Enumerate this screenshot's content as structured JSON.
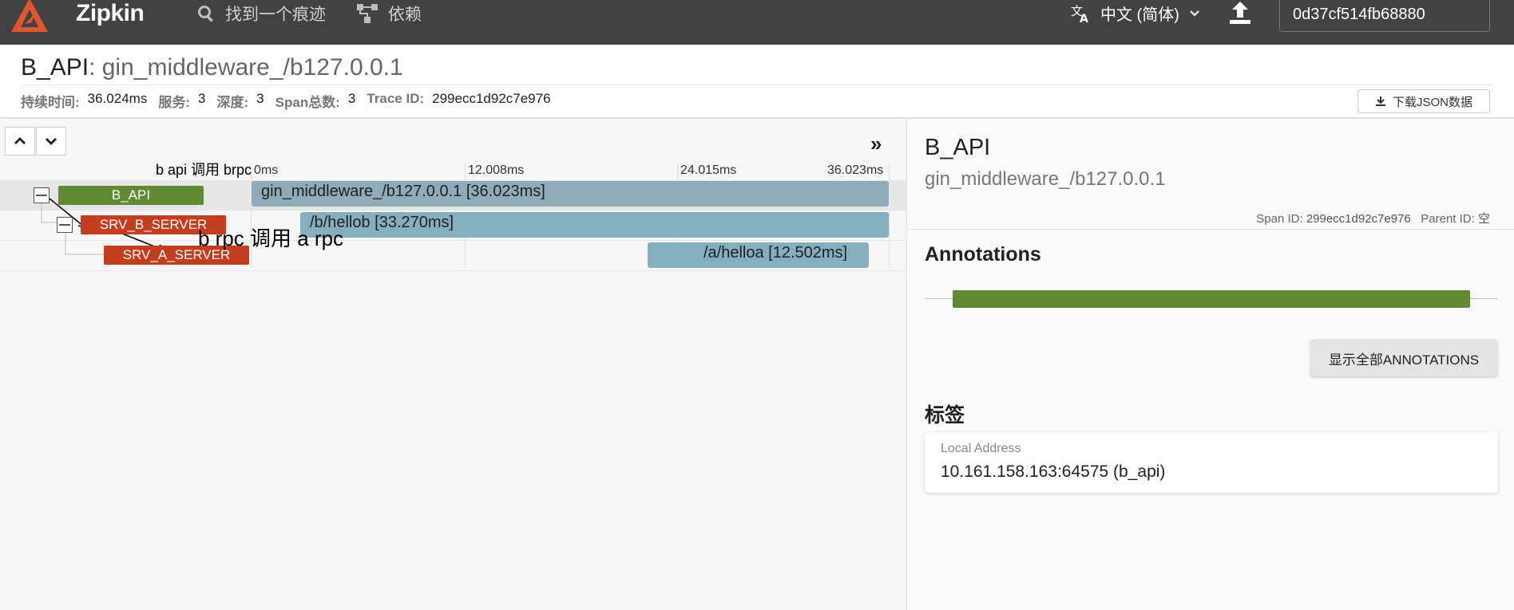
{
  "appbar": {
    "brand": "Zipkin",
    "nav": [
      {
        "label": "找到一个痕迹",
        "icon": "search-icon"
      },
      {
        "label": "依赖",
        "icon": "dependency-icon"
      }
    ],
    "language": "中文 (简体)",
    "trace_id_value": "0d37cf514fb68880",
    "colors": {
      "bar": "#424242",
      "logo": "#e1562a"
    }
  },
  "header": {
    "service": "B_API",
    "sep": ": ",
    "span_name": "gin_middleware_/b127.0.0.1",
    "meta": [
      {
        "key": "持续时间:",
        "value": "36.024ms"
      },
      {
        "key": "服务:",
        "value": "3"
      },
      {
        "key": "深度:",
        "value": "3"
      },
      {
        "key": "Span总数:",
        "value": "3"
      },
      {
        "key": "Trace ID:",
        "value": "299ecc1d92c7e976"
      }
    ],
    "download_label": "下载JSON数据"
  },
  "timeline": {
    "ticks": [
      "0ms",
      "12.008ms",
      "24.015ms",
      "36.023ms"
    ],
    "annotations": [
      "b api 调用 brpc",
      "b rpc 调用 a rpc"
    ],
    "rows": [
      {
        "service": "B_API",
        "color": "#5f8a31",
        "span": "gin_middleware_/b127.0.0.1 [36.023ms]",
        "start_ms": 0,
        "duration_ms": 36.023
      },
      {
        "service": "SRV_B_SERVER",
        "color": "#c23e1e",
        "span": "/b/hellob [33.270ms]",
        "start_ms": 2.75,
        "duration_ms": 33.27
      },
      {
        "service": "SRV_A_SERVER",
        "color": "#c23e1e",
        "span": "/a/helloa [12.502ms]",
        "start_ms": 22.6,
        "duration_ms": 12.502
      }
    ]
  },
  "detail": {
    "service": "B_API",
    "span_name": "gin_middleware_/b127.0.0.1",
    "span_id_label": "Span ID:",
    "span_id": "299ecc1d92c7e976",
    "parent_id_label": "Parent ID:",
    "parent_id": "空",
    "annotations_heading": "Annotations",
    "show_all_label": "显示全部ANNOTATIONS",
    "tags_heading": "标签",
    "tag_key": "Local Address",
    "tag_value": "10.161.158.163:64575 (b_api)"
  }
}
